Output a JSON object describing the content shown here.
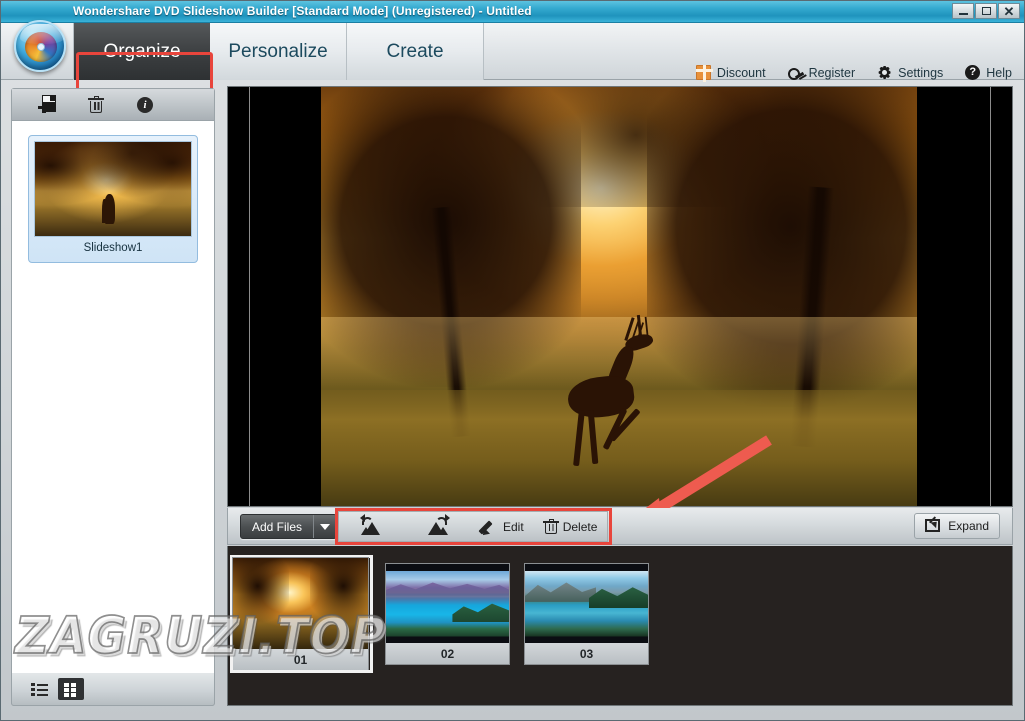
{
  "window": {
    "title": "Wondershare DVD Slideshow Builder [Standard Mode] (Unregistered) - Untitled",
    "minimize_label": "Minimize",
    "maximize_label": "Maximize",
    "close_label": "Close",
    "logo_name": "wondershare-dvd-logo"
  },
  "tabs": [
    {
      "label": "Organize",
      "active": true
    },
    {
      "label": "Personalize",
      "active": false
    },
    {
      "label": "Create",
      "active": false
    }
  ],
  "menu": [
    {
      "label": "Discount",
      "icon": "gift-icon"
    },
    {
      "label": "Register",
      "icon": "key-icon"
    },
    {
      "label": "Settings",
      "icon": "gear-icon"
    },
    {
      "label": "Help",
      "icon": "help-icon"
    }
  ],
  "sidebar": {
    "toolbar": [
      {
        "icon": "add-slideshow-icon",
        "label": "Add Slideshow"
      },
      {
        "icon": "delete-icon",
        "label": "Delete Slideshow"
      },
      {
        "icon": "info-icon",
        "label": "Slideshow Info"
      }
    ],
    "slideshows": [
      {
        "label": "Slideshow1",
        "selected": true
      }
    ],
    "view_modes": [
      {
        "icon": "list-view-icon",
        "label": "List View",
        "selected": false
      },
      {
        "icon": "grid-view-icon",
        "label": "Thumbnail View",
        "selected": true
      }
    ]
  },
  "preview": {
    "name": "preview-pane",
    "letterbox": true
  },
  "bottom_toolbar": {
    "add_files_label": "Add Files",
    "add_files_dropdown": "chevron-down-icon",
    "tools": [
      {
        "label": "",
        "icon": "rotate-left-icon"
      },
      {
        "label": "",
        "icon": "rotate-right-icon"
      },
      {
        "label": "Edit",
        "icon": "pencil-icon"
      },
      {
        "label": "Delete",
        "icon": "trash-icon"
      }
    ],
    "expand_label": "Expand",
    "expand_icon": "expand-icon"
  },
  "filmstrip": {
    "items": [
      {
        "caption": "01",
        "selected": true,
        "thumb": "sunset-deer"
      },
      {
        "caption": "02",
        "selected": false,
        "thumb": "blue-lake"
      },
      {
        "caption": "03",
        "selected": false,
        "thumb": "green-lake"
      }
    ]
  },
  "annotations": {
    "highlight_color": "#e8453c",
    "arrow_color": "#ee5b4f",
    "watermark": "ZAGRUZI.TOP"
  }
}
